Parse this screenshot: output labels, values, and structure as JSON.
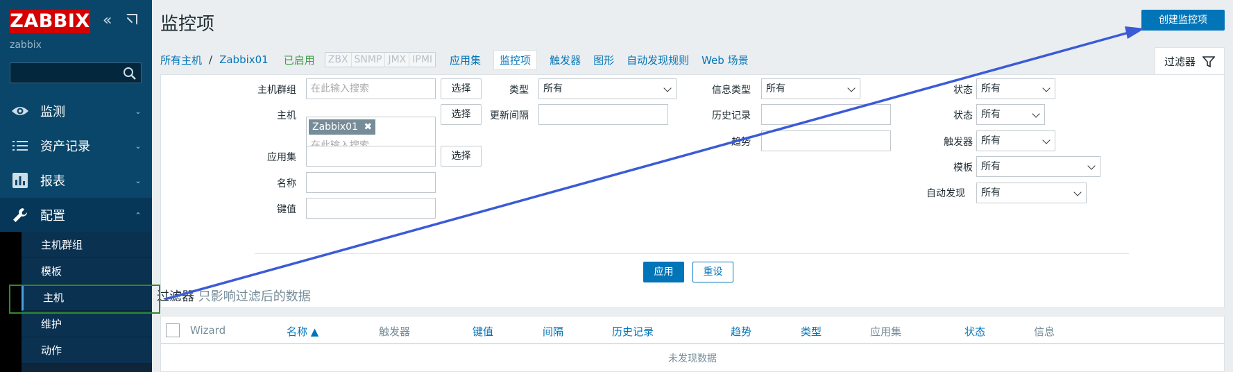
{
  "sidebar": {
    "logo": "ZABBIX",
    "user": "zabbix",
    "menu": [
      {
        "label": "监测",
        "icon": "eye-icon"
      },
      {
        "label": "资产记录",
        "icon": "list-icon"
      },
      {
        "label": "报表",
        "icon": "bar-chart-icon"
      },
      {
        "label": "配置",
        "icon": "wrench-icon"
      }
    ],
    "submenu": [
      "主机群组",
      "模板",
      "主机",
      "维护",
      "动作"
    ]
  },
  "header": {
    "title": "监控项",
    "create_button": "创建监控项"
  },
  "subnav": {
    "all_hosts": "所有主机",
    "separator": "/",
    "host": "Zabbix01",
    "status": "已启用",
    "tags": [
      "ZBX",
      "SNMP",
      "JMX",
      "IPMI"
    ],
    "links": [
      "应用集",
      "监控项",
      "触发器",
      "图形",
      "自动发现规则",
      "Web 场景"
    ]
  },
  "filter": {
    "tab_label": "过滤器",
    "host_group_label": "主机群组",
    "search_placeholder": "在此输入搜索",
    "select_button": "选择",
    "host_label": "主机",
    "host_tag": "Zabbix01",
    "application_label": "应用集",
    "name_label": "名称",
    "key_label": "键值",
    "type_label": "类型",
    "type_value": "所有",
    "update_interval_label": "更新间隔",
    "info_type_label": "信息类型",
    "info_type_value": "所有",
    "history_label": "历史记录",
    "trend_label": "趋势",
    "state_label": "状态",
    "state_value": "所有",
    "status_label": "状态",
    "status_value": "所有",
    "triggers_label": "触发器",
    "triggers_value": "所有",
    "template_label": "模板",
    "template_value": "所有",
    "discovery_label": "自动发现",
    "discovery_value": "所有",
    "apply_button": "应用",
    "reset_button": "重设",
    "note_title": "过滤器",
    "note_text": "只影响过滤后的数据"
  },
  "table": {
    "columns": [
      "Wizard",
      "名称 ▲",
      "触发器",
      "键值",
      "间隔",
      "历史记录",
      "趋势",
      "类型",
      "应用集",
      "状态",
      "信息"
    ],
    "empty_text": "未发现数据"
  },
  "colors": {
    "sidebar_bg": "#0a466a",
    "accent": "#0275b8",
    "logo": "#d40000",
    "annotation_arrow": "#3b5bd6",
    "annotation_box": "#2e8b2e"
  }
}
